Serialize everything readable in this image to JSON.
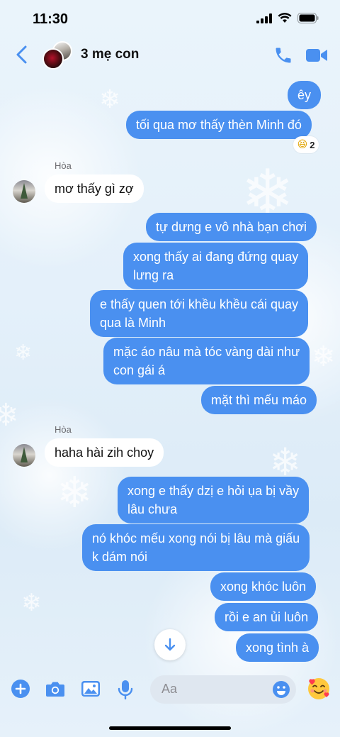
{
  "status_bar": {
    "time": "11:30"
  },
  "header": {
    "title": "3 mẹ con"
  },
  "messages": {
    "m1": "êy",
    "m2": "tối qua mơ thấy thèn Minh đó",
    "m2_reaction": {
      "emoji": "😆",
      "count": "2"
    },
    "hoa_name_1": "Hòa",
    "m3": "mơ thấy gì zợ",
    "m4": "tự dưng e vô nhà bạn chơi",
    "m5_l1": "xong thấy ai đang đứng quay",
    "m5_l2": "lưng ra",
    "m6_l1": "e thấy quen tới khều khều cái quay",
    "m6_l2": "qua là Minh",
    "m7_l1": "mặc áo nâu mà tóc vàng dài như",
    "m7_l2": "con gái á",
    "m8": "mặt thì mếu máo",
    "hoa_name_2": "Hòa",
    "m9": "haha hài zih choy",
    "m10_l1": "xong e thấy dzị e hỏi ụa bị vầy",
    "m10_l2": "lâu chưa",
    "m11_l1": "nó khóc mếu xong nói bị lâu mà giấu",
    "m11_l2": "k dám nói",
    "m12": "xong khóc luôn",
    "m13": "rồi e an ủi luôn",
    "m14": "xong tình à"
  },
  "composer": {
    "placeholder": "Aa"
  },
  "colors": {
    "accent": "#4a90f0",
    "outgoing_bubble": "#4a90f0",
    "incoming_bubble": "#ffffff"
  },
  "icons": [
    "back-icon",
    "phone-icon",
    "video-icon",
    "plus-icon",
    "camera-icon",
    "gallery-icon",
    "mic-icon",
    "emoji-icon",
    "sticker-icon",
    "arrow-down-icon"
  ]
}
